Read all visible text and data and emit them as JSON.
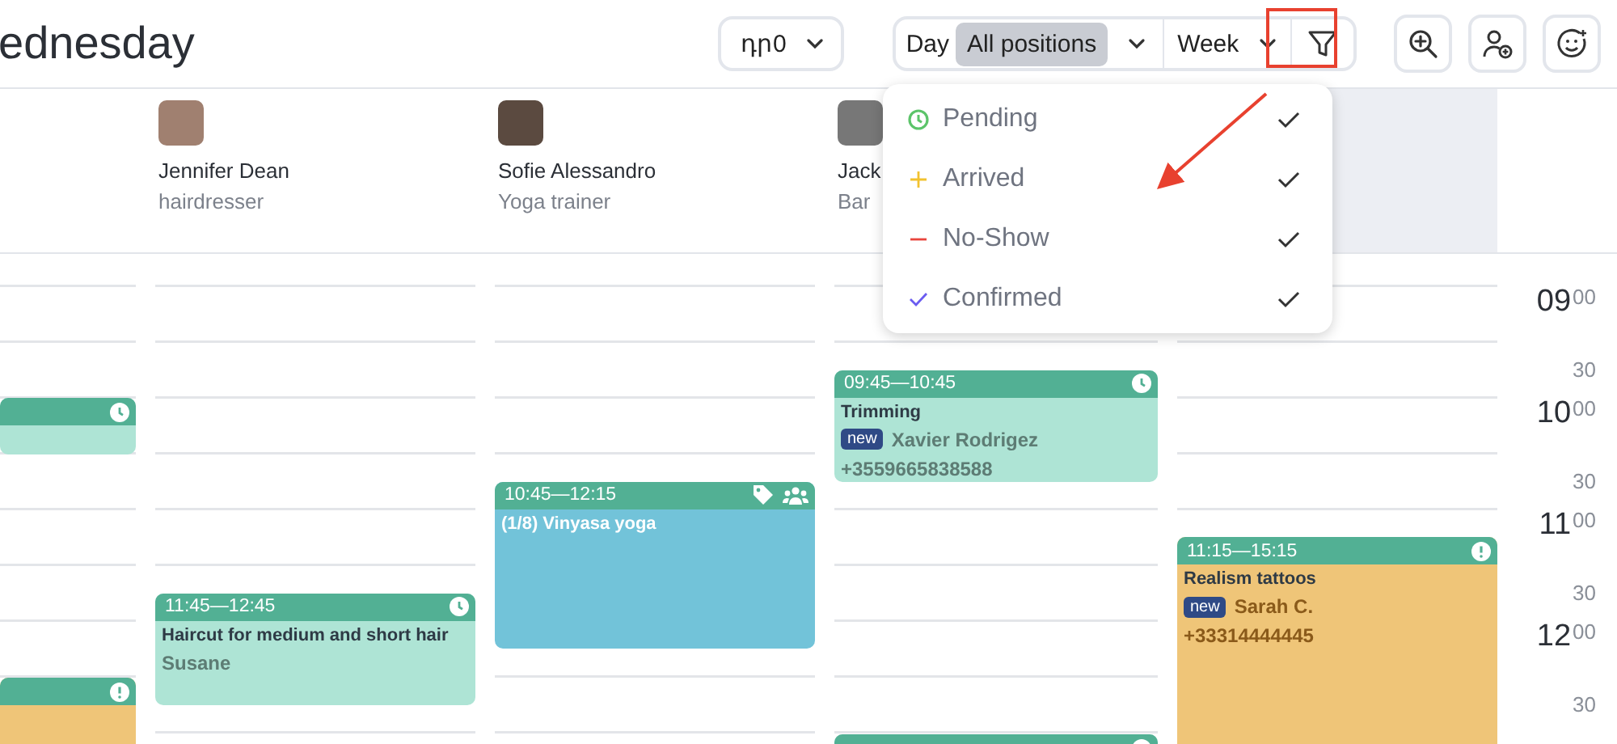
{
  "header": {
    "title": "ednesday",
    "location_select": {
      "value": "դր0"
    },
    "day_label": "Day",
    "position_select": {
      "value": "All positions"
    },
    "period_select": {
      "value": "Week"
    }
  },
  "staff": [
    {
      "highlighted": false
    },
    {
      "name": "Jennifer Dean",
      "role": "hairdresser",
      "highlighted": false
    },
    {
      "name": "Sofie Alessandro",
      "role": "Yoga trainer",
      "highlighted": false
    },
    {
      "name": "Jack",
      "role": "Bar",
      "highlighted": false
    },
    {
      "highlighted": true
    }
  ],
  "columns": [
    {
      "events": [
        {
          "kind": "pending",
          "color": "#aee4d5"
        },
        {
          "kind": "notice",
          "color": "#efc578"
        }
      ]
    },
    {
      "events": [
        {
          "kind": "pending",
          "color": "#aee4d5",
          "time": "11:45—12:45",
          "service": "Haircut for medium and short hair",
          "client": "Susane"
        }
      ]
    },
    {
      "events": [
        {
          "kind": "group",
          "color": "#72c3d9",
          "time": "10:45—12:15",
          "service": "(1/8) Vinyasa yoga"
        }
      ]
    },
    {
      "events": [
        {
          "kind": "pending",
          "color": "#aee4d5",
          "time": "09:45—10:45",
          "service": "Trimming",
          "client": "Xavier Rodrigez",
          "new_client": true,
          "new_badge": "new",
          "phone": "+3559665838588"
        },
        {
          "kind": "pending",
          "color": "#aee4d5"
        }
      ]
    },
    {
      "events": [
        {
          "kind": "notice",
          "color": "#efc578",
          "time": "11:15—15:15",
          "service": "Realism tattoos",
          "client": "Sarah C.",
          "new_client": true,
          "new_badge": "new",
          "phone": "+33314444445"
        }
      ]
    }
  ],
  "time_scale": [
    {
      "hour": "09",
      "minutes": "00"
    },
    {
      "minutes": "30"
    },
    {
      "hour": "10",
      "minutes": "00"
    },
    {
      "minutes": "30"
    },
    {
      "hour": "11",
      "minutes": "00"
    },
    {
      "minutes": "30"
    },
    {
      "hour": "12",
      "minutes": "00"
    },
    {
      "minutes": "30"
    }
  ],
  "filter_menu": {
    "items": [
      {
        "kind": "pending",
        "color": "#5cc46a",
        "label": "Pending",
        "checked": true
      },
      {
        "kind": "arrived",
        "color": "#f2c230",
        "label": "Arrived",
        "checked": true
      },
      {
        "kind": "noshow",
        "color": "#e8453c",
        "label": "No-Show",
        "checked": true
      },
      {
        "kind": "confirmed",
        "color": "#6b5cf0",
        "label": "Confirmed",
        "checked": true
      }
    ]
  }
}
